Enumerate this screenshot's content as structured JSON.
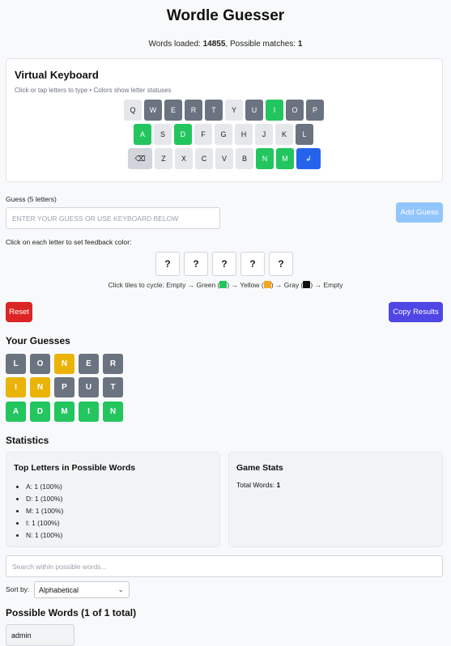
{
  "app": {
    "title": "Wordle Guesser",
    "status_prefix": "Words loaded:",
    "words_loaded": "14855",
    "status_mid": ", Possible matches:",
    "possible_matches": "1"
  },
  "keyboard": {
    "title": "Virtual Keyboard",
    "subtitle": "Click or tap letters to type • Colors show letter statuses",
    "row1": [
      {
        "k": "Q",
        "s": "default"
      },
      {
        "k": "W",
        "s": "gray"
      },
      {
        "k": "E",
        "s": "gray"
      },
      {
        "k": "R",
        "s": "gray"
      },
      {
        "k": "T",
        "s": "gray"
      },
      {
        "k": "Y",
        "s": "default"
      },
      {
        "k": "U",
        "s": "gray"
      },
      {
        "k": "I",
        "s": "green"
      },
      {
        "k": "O",
        "s": "gray"
      },
      {
        "k": "P",
        "s": "gray"
      }
    ],
    "row2": [
      {
        "k": "A",
        "s": "green"
      },
      {
        "k": "S",
        "s": "default"
      },
      {
        "k": "D",
        "s": "green"
      },
      {
        "k": "F",
        "s": "default"
      },
      {
        "k": "G",
        "s": "default"
      },
      {
        "k": "H",
        "s": "default"
      },
      {
        "k": "J",
        "s": "default"
      },
      {
        "k": "K",
        "s": "default"
      },
      {
        "k": "L",
        "s": "gray"
      }
    ],
    "row3": [
      {
        "k": "⌫",
        "s": "dark"
      },
      {
        "k": "Z",
        "s": "default"
      },
      {
        "k": "X",
        "s": "default"
      },
      {
        "k": "C",
        "s": "default"
      },
      {
        "k": "V",
        "s": "default"
      },
      {
        "k": "B",
        "s": "default"
      },
      {
        "k": "N",
        "s": "green"
      },
      {
        "k": "M",
        "s": "green"
      },
      {
        "k": "↲",
        "s": "blue"
      }
    ]
  },
  "guess": {
    "label": "Guess (5 letters)",
    "placeholder": "ENTER YOUR GUESS OR USE KEYBOARD BELOW",
    "add_label": "Add Guess",
    "feedback_label": "Click on each letter to set feedback color:",
    "tiles": [
      "?",
      "?",
      "?",
      "?",
      "?"
    ],
    "hint_a": "Click tiles to cycle: Empty → Green (",
    "hint_b": ") → Yellow (",
    "hint_c": ") → Gray (",
    "hint_d": ") → Empty"
  },
  "actions": {
    "reset_label": "Reset",
    "copy_label": "Copy Results"
  },
  "guesses": {
    "title": "Your Guesses",
    "rows": [
      [
        {
          "l": "L",
          "c": "gray"
        },
        {
          "l": "O",
          "c": "gray"
        },
        {
          "l": "N",
          "c": "yellow"
        },
        {
          "l": "E",
          "c": "gray"
        },
        {
          "l": "R",
          "c": "gray"
        }
      ],
      [
        {
          "l": "I",
          "c": "yellow"
        },
        {
          "l": "N",
          "c": "yellow"
        },
        {
          "l": "P",
          "c": "gray"
        },
        {
          "l": "U",
          "c": "gray"
        },
        {
          "l": "T",
          "c": "gray"
        }
      ],
      [
        {
          "l": "A",
          "c": "green"
        },
        {
          "l": "D",
          "c": "green"
        },
        {
          "l": "M",
          "c": "green"
        },
        {
          "l": "I",
          "c": "green"
        },
        {
          "l": "N",
          "c": "green"
        }
      ]
    ]
  },
  "statistics": {
    "title": "Statistics",
    "top_letters_title": "Top Letters in Possible Words",
    "top_letters": [
      "A: 1 (100%)",
      "D: 1 (100%)",
      "M: 1 (100%)",
      "I: 1 (100%)",
      "N: 1 (100%)"
    ],
    "game_stats_title": "Game Stats",
    "total_words_label": "Total Words:",
    "total_words_value": "1"
  },
  "search": {
    "placeholder": "Search within possible words...",
    "sort_label": "Sort by:",
    "sort_value": "Alphabetical"
  },
  "possible": {
    "title": "Possible Words (1 of 1 total)",
    "words": [
      "admin"
    ]
  },
  "colors": {
    "green": "#22c55e",
    "yellow": "#eab308",
    "gray": "#6b7280",
    "blue": "#2563eb",
    "red": "#dc2626",
    "indigo": "#4f46e5",
    "hint_green": "#22c55e",
    "hint_yellow": "#f5a623",
    "hint_gray": "#111111"
  }
}
